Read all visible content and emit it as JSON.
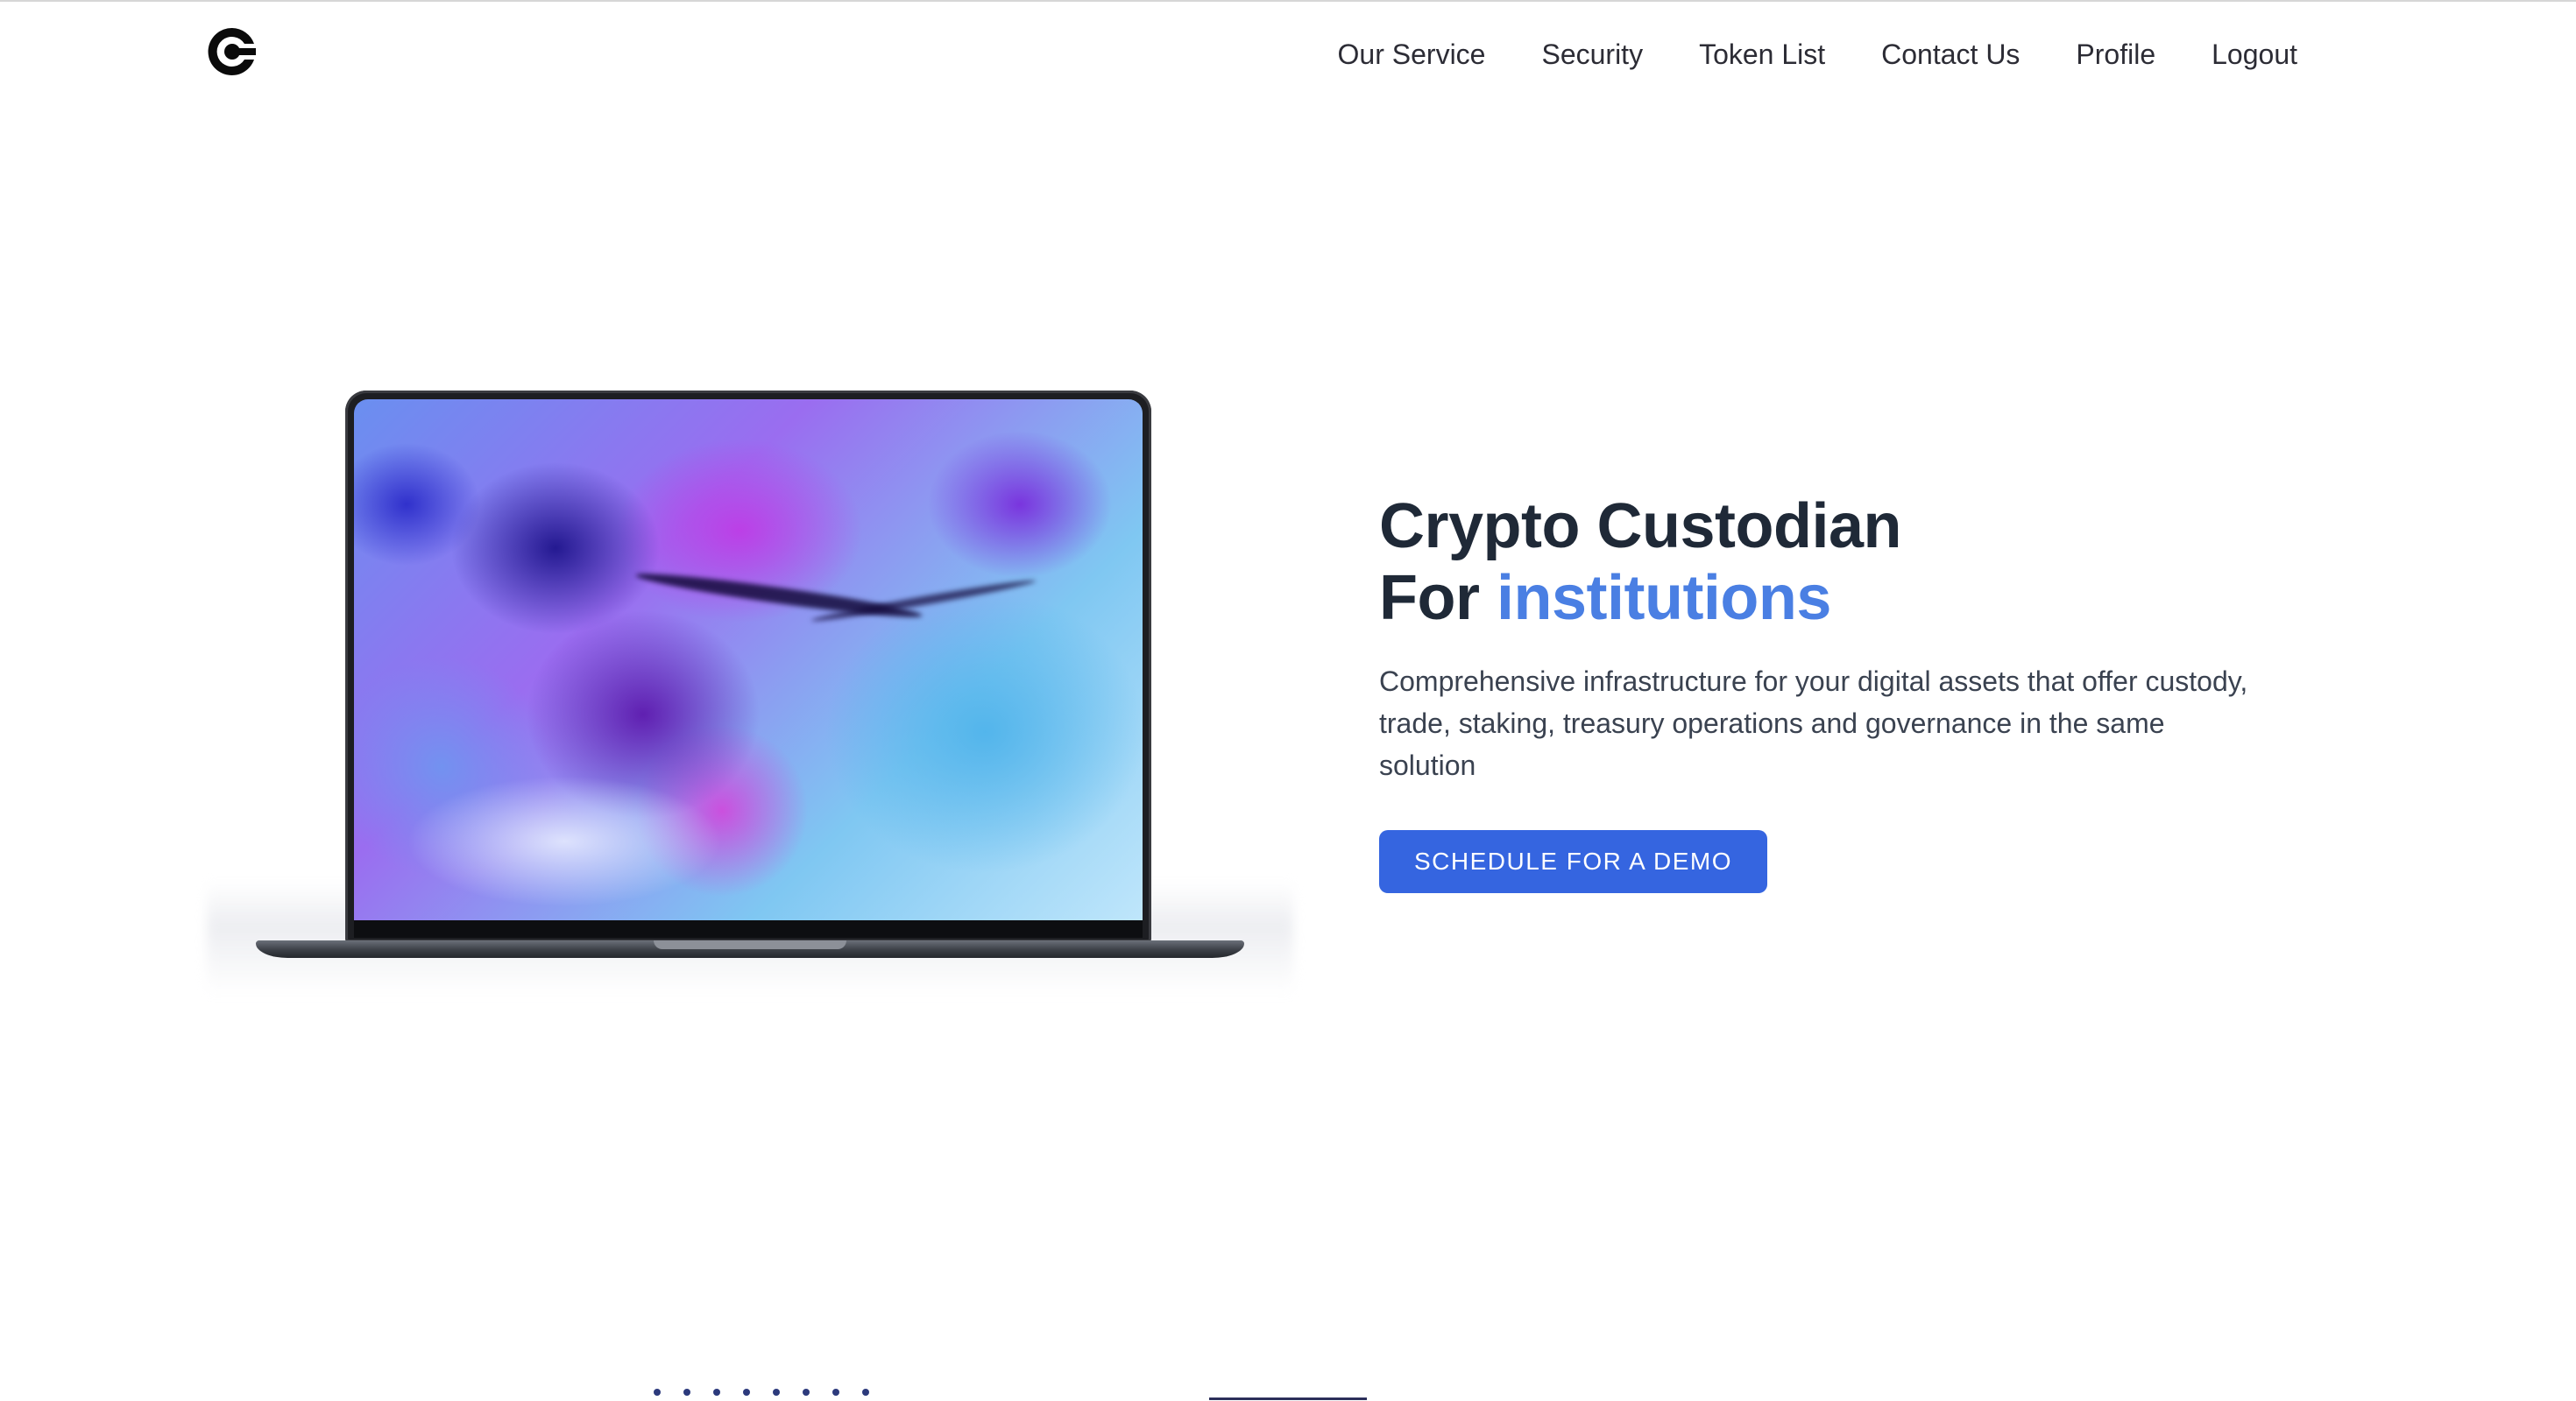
{
  "nav": {
    "logo_icon": "brand-c-logo-icon",
    "links": [
      {
        "label": "Our Service"
      },
      {
        "label": "Security"
      },
      {
        "label": "Token List"
      },
      {
        "label": "Contact Us"
      },
      {
        "label": "Profile"
      },
      {
        "label": "Logout"
      }
    ]
  },
  "hero": {
    "title_line1": "Crypto Custodian",
    "title_line2_prefix": "For ",
    "title_line2_accent": "institutions",
    "description": "Comprehensive infrastructure for your digital assets that offer custody, trade, staking, treasury operations and governance in the same solution",
    "cta_label": "SCHEDULE FOR A DEMO",
    "image": "laptop-with-abstract-ink-screen"
  },
  "colors": {
    "accent": "#4a7fe3",
    "button": "#3565e0",
    "text": "#1f2937"
  }
}
